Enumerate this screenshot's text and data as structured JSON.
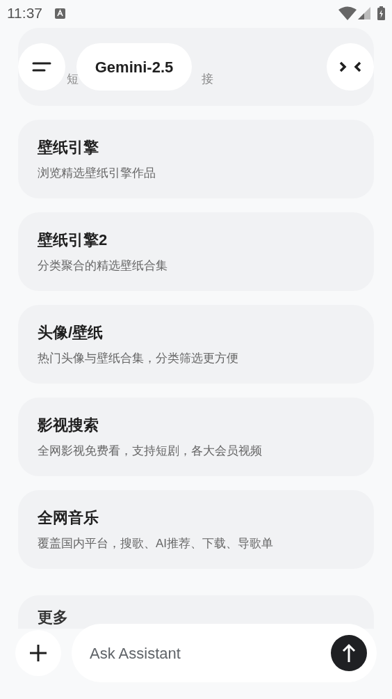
{
  "status_bar": {
    "time": "11:37"
  },
  "top_bar": {
    "model_title": "Gemini-2.5"
  },
  "partial_card": {
    "subtitle_parts": [
      "短",
      "接"
    ]
  },
  "cards": [
    {
      "title": "壁纸引擎",
      "subtitle": "浏览精选壁纸引擎作品"
    },
    {
      "title": "壁纸引擎2",
      "subtitle": "分类聚合的精选壁纸合集"
    },
    {
      "title": "头像/壁纸",
      "subtitle": "热门头像与壁纸合集，分类筛选更方便"
    },
    {
      "title": "影视搜索",
      "subtitle": "全网影视免费看，支持短剧，各大会员视频"
    },
    {
      "title": "全网音乐",
      "subtitle": "覆盖国内平台，搜歌、AI推荐、下载、导歌单"
    }
  ],
  "last_card": {
    "title": "更多"
  },
  "composer": {
    "placeholder": "Ask Assistant"
  }
}
